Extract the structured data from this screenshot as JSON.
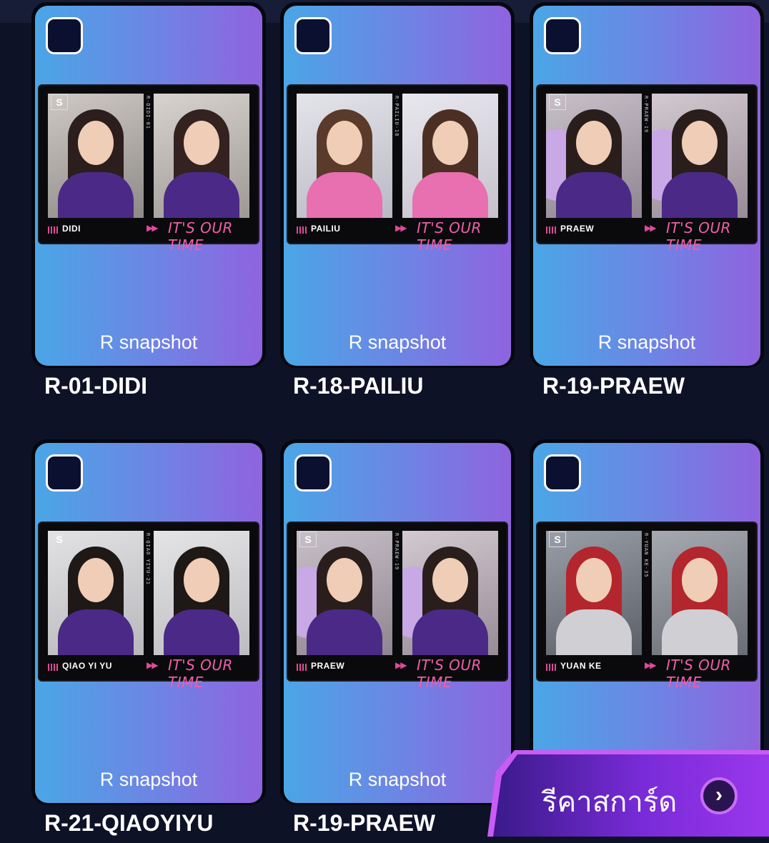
{
  "cards": [
    {
      "title": "R-01-DIDI",
      "rarity": "R snapshot",
      "member": "DIDI",
      "code": "R-DIDI-01",
      "slogan": "IT'S OUR TIME",
      "selected": false
    },
    {
      "title": "R-18-PAILIU",
      "rarity": "R snapshot",
      "member": "PAILIU",
      "code": "R-PAILIU-18",
      "slogan": "IT'S OUR TIME",
      "selected": false
    },
    {
      "title": "R-19-PRAEW",
      "rarity": "R snapshot",
      "member": "PRAEW",
      "code": "R-PRAEW-19",
      "slogan": "IT'S OUR TIME",
      "selected": false
    },
    {
      "title": "R-21-QIAOYIYU",
      "rarity": "R snapshot",
      "member": "QIAO YI YU",
      "code": "R-QIAO YIYU-21",
      "slogan": "IT'S OUR TIME",
      "selected": false
    },
    {
      "title": "R-19-PRAEW",
      "rarity": "R snapshot",
      "member": "PRAEW",
      "code": "R-PRAEW-19",
      "slogan": "IT'S OUR TIME",
      "selected": false
    },
    {
      "title": "",
      "rarity": "",
      "member": "YUAN KE",
      "code": "R-YUAN KE-35",
      "slogan": "IT'S OUR TIME",
      "selected": false
    }
  ],
  "reroll_button": {
    "label": "รีคาสการ์ด",
    "icon": "chevron-right-icon"
  },
  "colors": {
    "background": "#0d1226",
    "card_gradient_start": "#4aa6e6",
    "card_gradient_end": "#8f63df",
    "accent_pink": "#ee5fa8",
    "button_purple": "#7a2bd8"
  }
}
